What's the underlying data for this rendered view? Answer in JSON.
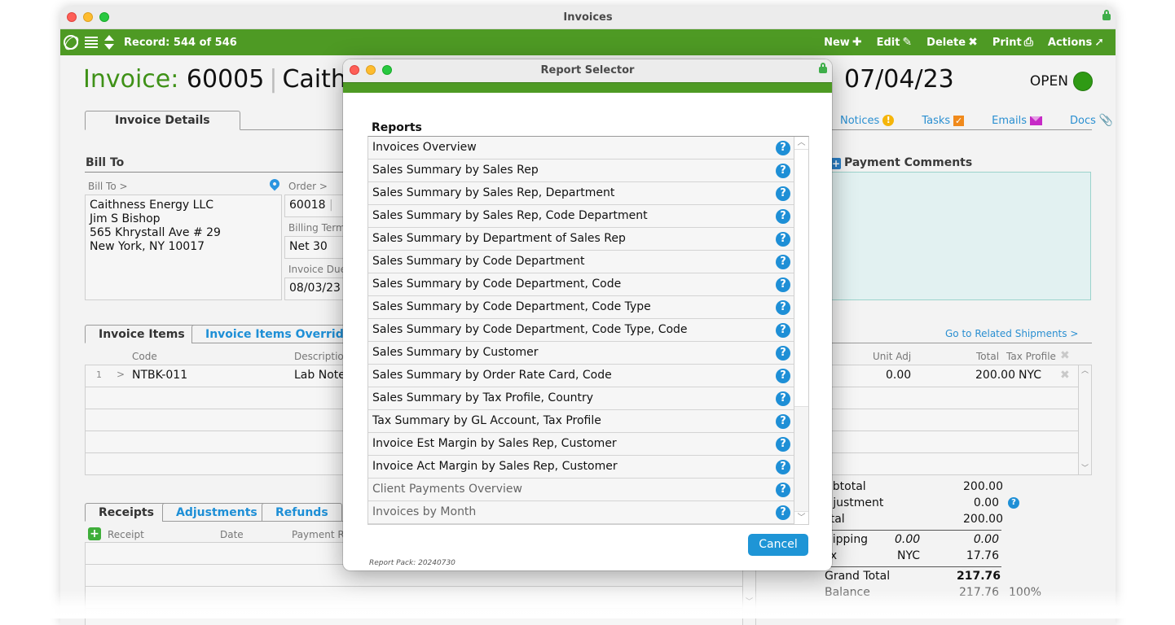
{
  "window": {
    "title": "Invoices"
  },
  "toolbar": {
    "record": "Record: 544 of 546",
    "new": "New",
    "edit": "Edit",
    "delete": "Delete",
    "print": "Print",
    "actions": "Actions",
    "color": "#4e9a24"
  },
  "header": {
    "label": "Invoice:",
    "number": "60005",
    "separator": "|",
    "customer": "Caithness Energy LLC",
    "date": "07/04/23",
    "status": "OPEN",
    "status_color": "#2f9a14"
  },
  "tabs": {
    "invoice_details": "Invoice Details"
  },
  "links": {
    "notices": "Notices",
    "tasks": "Tasks",
    "emails": "Emails",
    "docs": "Docs"
  },
  "bill_to": {
    "section": "Bill To",
    "label": "Bill To >",
    "lines": [
      "Caithness Energy LLC",
      "Jim S Bishop",
      "565 Khrystall Ave # 29",
      "New York, NY 10017"
    ],
    "order_label": "Order >",
    "order_value": "60018",
    "billing_terms_label": "Billing Terms",
    "billing_terms_value": "Net 30",
    "invoice_due_label": "Invoice Due",
    "invoice_due_value": "08/03/23"
  },
  "payment_comments": {
    "label": "Payment Comments",
    "value": ""
  },
  "items": {
    "tabs": [
      "Invoice Items",
      "Invoice Items Override"
    ],
    "related_link": "Go to Related Shipments >",
    "columns": {
      "code": "Code",
      "description": "Description",
      "unit_adj": "Unit Adj",
      "total": "Total",
      "tax_profile": "Tax Profile"
    },
    "rows": [
      {
        "num": "1",
        "expand": ">",
        "code": "NTBK-011",
        "description": "Lab Notebook",
        "unit_adj": "0.00",
        "total": "200.00",
        "tax_profile": "NYC"
      }
    ]
  },
  "receipts": {
    "tabs": [
      "Receipts",
      "Adjustments",
      "Refunds"
    ],
    "columns": {
      "receipt": "Receipt",
      "date": "Date",
      "payment_ref": "Payment Ref"
    }
  },
  "totals": {
    "subtotal_label": "Subtotal",
    "subtotal": "200.00",
    "adjustment_label": "Adjustment",
    "adjustment": "0.00",
    "total_label": "Total",
    "total": "200.00",
    "shipping_label": "Shipping",
    "shipping_mid": "0.00",
    "shipping": "0.00",
    "tax_label": "Tax",
    "tax_profile": "NYC",
    "tax": "17.76",
    "grand_total_label": "Grand Total",
    "grand_total": "217.76",
    "balance_label": "Balance",
    "balance": "217.76",
    "balance_pct": "100%"
  },
  "dialog": {
    "title": "Report Selector",
    "reports_label": "Reports",
    "reports": [
      {
        "name": "Invoices Overview",
        "dim": false
      },
      {
        "name": "Sales Summary by Sales Rep",
        "dim": false
      },
      {
        "name": "Sales Summary by Sales Rep, Department",
        "dim": false
      },
      {
        "name": "Sales Summary by Sales Rep, Code Department",
        "dim": false
      },
      {
        "name": "Sales Summary by Department of Sales Rep",
        "dim": false
      },
      {
        "name": "Sales Summary by Code Department",
        "dim": false
      },
      {
        "name": "Sales Summary by Code Department, Code",
        "dim": false
      },
      {
        "name": "Sales Summary by Code Department, Code Type",
        "dim": false
      },
      {
        "name": "Sales Summary by Code Department, Code Type, Code",
        "dim": false
      },
      {
        "name": "Sales Summary by Customer",
        "dim": false
      },
      {
        "name": "Sales Summary by Order Rate Card, Code",
        "dim": false
      },
      {
        "name": "Sales Summary by Tax Profile, Country",
        "dim": false
      },
      {
        "name": "Tax Summary by GL Account, Tax Profile",
        "dim": false
      },
      {
        "name": "Invoice Est Margin by Sales Rep, Customer",
        "dim": false
      },
      {
        "name": "Invoice Act Margin by Sales Rep, Customer",
        "dim": false
      },
      {
        "name": "Client Payments Overview",
        "dim": true
      },
      {
        "name": "Invoices by Month",
        "dim": true
      }
    ],
    "help_glyph": "?",
    "cancel": "Cancel",
    "report_pack": "Report Pack: 20240730"
  }
}
